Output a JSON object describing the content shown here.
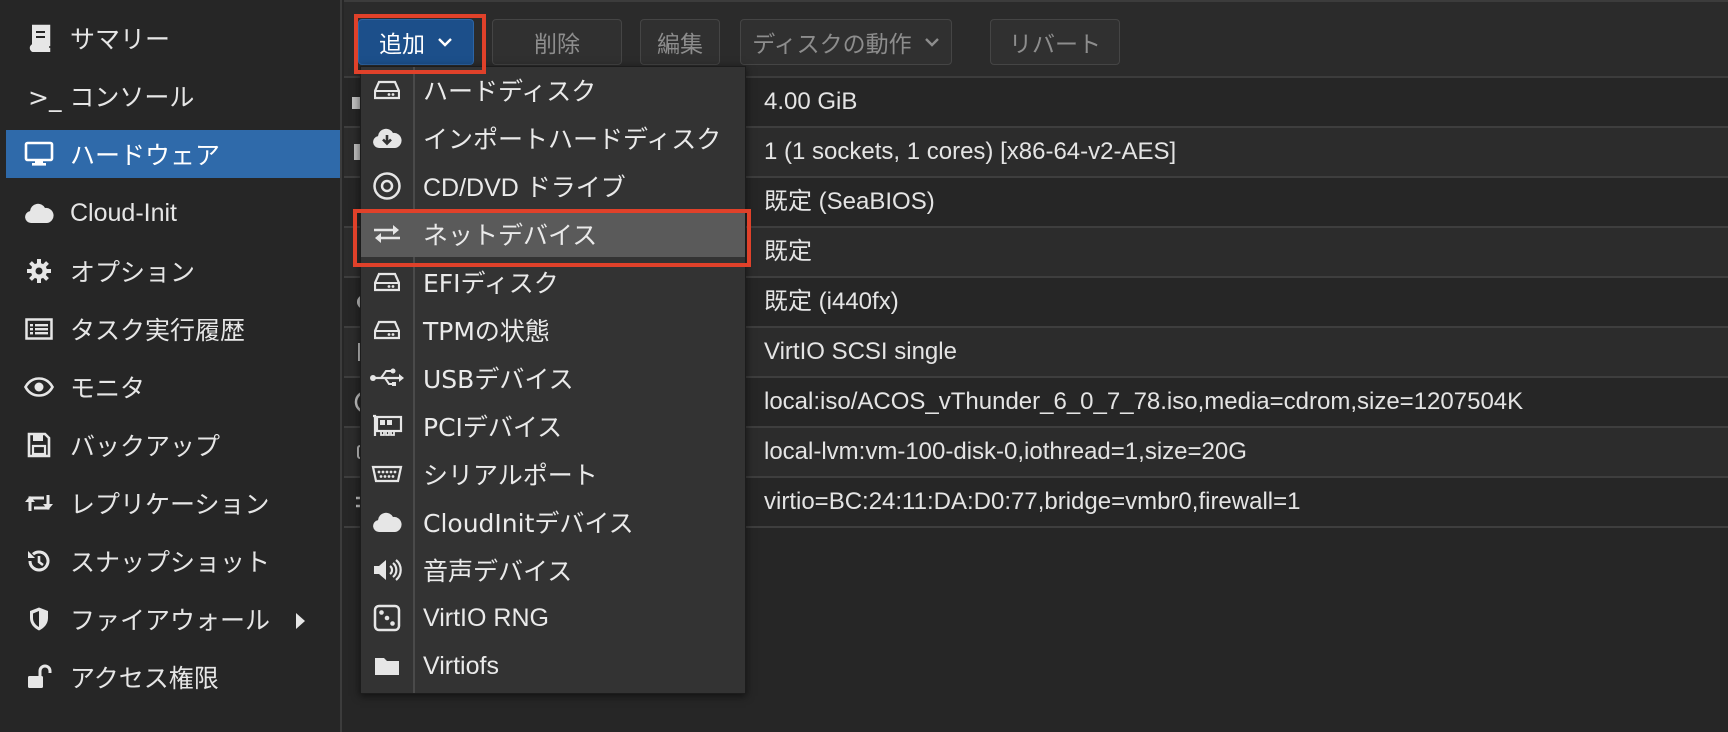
{
  "sidebar": {
    "items": [
      {
        "label": "サマリー",
        "icon": "book-icon"
      },
      {
        "label": ">_ コンソール",
        "icon": "terminal-icon"
      },
      {
        "label": "ハードウェア",
        "icon": "desktop-icon",
        "active": true
      },
      {
        "label": "Cloud-Init",
        "icon": "cloud-icon"
      },
      {
        "label": "オプション",
        "icon": "gear-icon"
      },
      {
        "label": "タスク実行履歴",
        "icon": "list-icon"
      },
      {
        "label": "モニタ",
        "icon": "eye-icon"
      },
      {
        "label": "バックアップ",
        "icon": "floppy-icon"
      },
      {
        "label": "レプリケーション",
        "icon": "retweet-icon"
      },
      {
        "label": "スナップショット",
        "icon": "history-icon"
      },
      {
        "label": "ファイアウォール",
        "icon": "shield-icon",
        "has_submenu": true
      },
      {
        "label": "アクセス権限",
        "icon": "unlock-icon"
      }
    ]
  },
  "toolbar": {
    "add_label": "追加",
    "delete_label": "削除",
    "edit_label": "編集",
    "disk_action_label": "ディスクの動作",
    "revert_label": "リバート"
  },
  "hardware": {
    "values": [
      "4.00 GiB",
      "1 (1 sockets, 1 cores) [x86-64-v2-AES]",
      "既定 (SeaBIOS)",
      "既定",
      "既定 (i440fx)",
      "VirtIO SCSI single",
      "local:iso/ACOS_vThunder_6_0_7_78.iso,media=cdrom,size=1207504K",
      "local-lvm:vm-100-disk-0,iothread=1,size=20G",
      "virtio=BC:24:11:DA:D0:77,bridge=vmbr0,firewall=1"
    ]
  },
  "add_menu": {
    "items": [
      {
        "label": "ハードディスク",
        "icon": "hdd-icon"
      },
      {
        "label": "インポートハードディスク",
        "icon": "cloud-download-icon"
      },
      {
        "label": "CD/DVD ドライブ",
        "icon": "disc-icon"
      },
      {
        "label": "ネットデバイス",
        "icon": "exchange-icon",
        "highlighted": true
      },
      {
        "label": "EFIディスク",
        "icon": "hdd-icon"
      },
      {
        "label": "TPMの状態",
        "icon": "hdd-icon"
      },
      {
        "label": "USBデバイス",
        "icon": "usb-icon"
      },
      {
        "label": "PCIデバイス",
        "icon": "pci-card-icon"
      },
      {
        "label": "シリアルポート",
        "icon": "serial-port-icon"
      },
      {
        "label": "CloudInitデバイス",
        "icon": "cloud-icon"
      },
      {
        "label": "音声デバイス",
        "icon": "volume-icon"
      },
      {
        "label": "VirtIO RNG",
        "icon": "dice-icon"
      },
      {
        "label": "Virtiofs",
        "icon": "folder-icon"
      }
    ]
  },
  "colors": {
    "accent_blue": "#2f6aaa",
    "primary_button": "#1c4f8a",
    "highlight_box": "#e0412a"
  }
}
